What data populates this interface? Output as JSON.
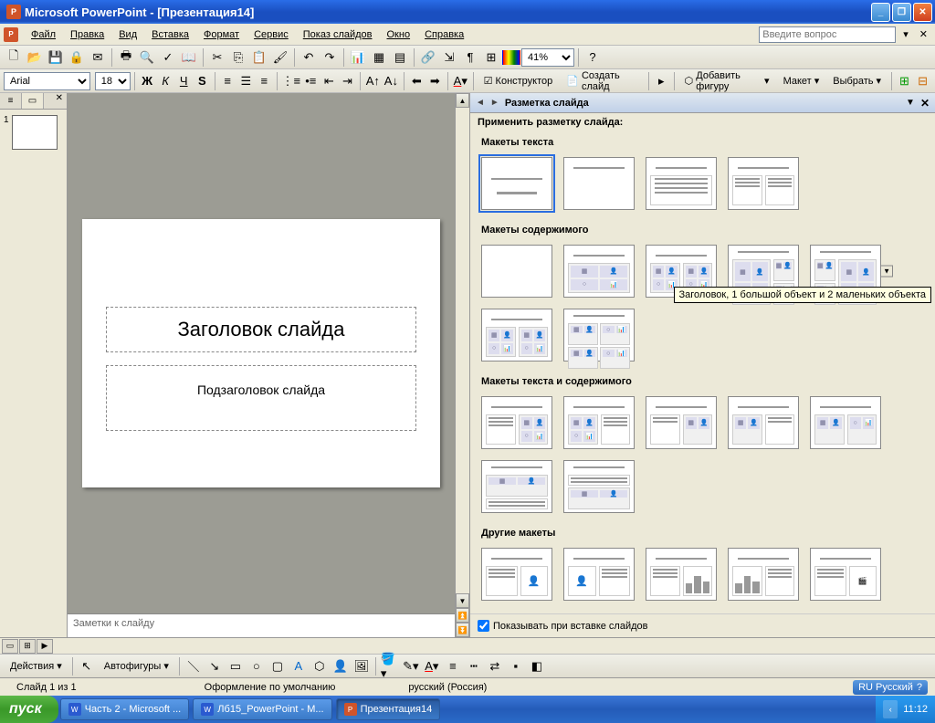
{
  "titlebar": {
    "app": "Microsoft PowerPoint",
    "doc": "[Презентация14]"
  },
  "menubar": {
    "items": [
      "Файл",
      "Правка",
      "Вид",
      "Вставка",
      "Формат",
      "Сервис",
      "Показ слайдов",
      "Окно",
      "Справка"
    ],
    "question_placeholder": "Введите вопрос"
  },
  "toolbar1": {
    "zoom": "41%"
  },
  "toolbar2": {
    "font": "Arial",
    "size": "18",
    "constructor_label": "Конструктор",
    "new_slide_label": "Создать слайд",
    "add_shape_label": "Добавить фигуру",
    "layout_label": "Макет",
    "select_label": "Выбрать"
  },
  "slide_panel": {
    "num": "1"
  },
  "slide": {
    "title": "Заголовок слайда",
    "subtitle": "Подзаголовок слайда"
  },
  "notes": {
    "placeholder": "Заметки к слайду"
  },
  "task_pane": {
    "title": "Разметка слайда",
    "subtitle": "Применить разметку слайда:",
    "group1": "Макеты текста",
    "group2": "Макеты содержимого",
    "group3": "Макеты текста и содержимого",
    "group4": "Другие макеты",
    "tooltip": "Заголовок, 1 большой объект и 2 маленьких объекта",
    "show_on_insert": "Показывать при вставке слайдов"
  },
  "draw_toolbar": {
    "actions": "Действия",
    "autoshapes": "Автофигуры"
  },
  "status": {
    "slide_info": "Слайд 1 из 1",
    "design": "Оформление по умолчанию",
    "lang": "русский (Россия)",
    "lang_indicator": "RU Русский"
  },
  "taskbar": {
    "start": "пуск",
    "items": [
      "Часть 2 - Microsoft ...",
      "Лб15_PowerPoint - M...",
      "Презентация14"
    ],
    "time": "11:12"
  }
}
